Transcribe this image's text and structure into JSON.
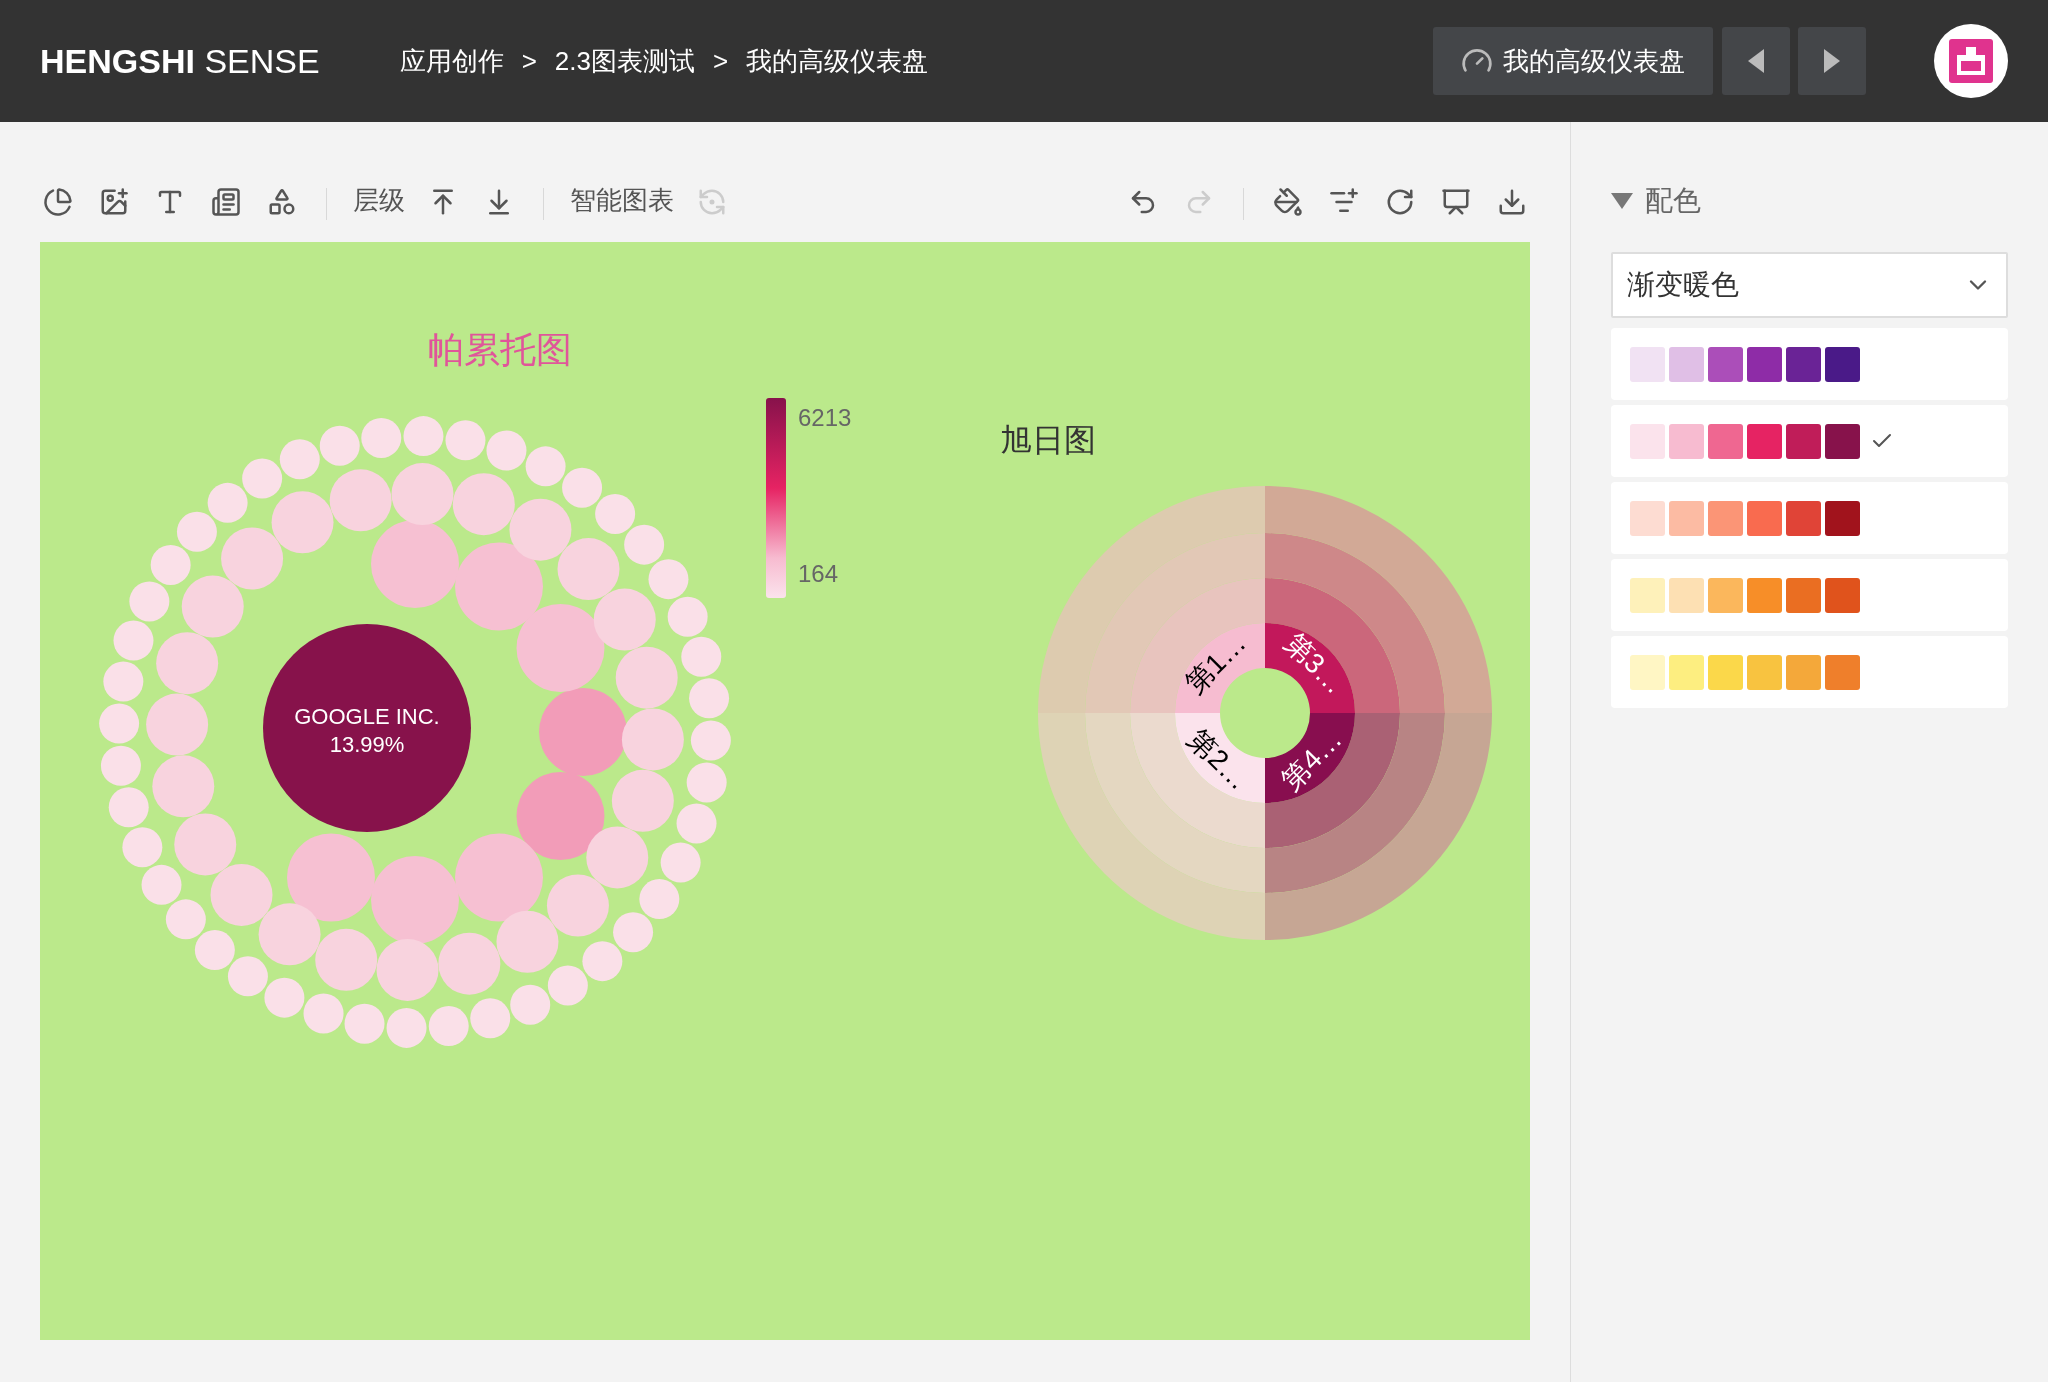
{
  "header": {
    "logo_bold": "HENGSHI",
    "logo_light": "SENSE",
    "breadcrumbs": [
      "应用创作",
      ">",
      "2.3图表测试",
      ">",
      "我的高级仪表盘"
    ],
    "dashboard_button": "我的高级仪表盘"
  },
  "toolbar": {
    "layer_label": "层级",
    "smart_chart_label": "智能图表",
    "smart_chart_icon_disabled": true,
    "undo_disabled": false,
    "redo_disabled": true
  },
  "bubble_chart": {
    "title": "帕累托图",
    "top_label": "GOOGLE INC.",
    "top_share": "13.99%",
    "legend_max": "6213",
    "legend_min": "164"
  },
  "sunburst": {
    "title": "旭日图",
    "segments": [
      {
        "label": "第1…",
        "color": "#f6bcd0"
      },
      {
        "label": "第3…",
        "color": "#c2185b"
      },
      {
        "label": "第4…",
        "color": "#880e4f"
      },
      {
        "label": "第2…",
        "color": "#fbe3ec"
      }
    ]
  },
  "sidebar": {
    "section_title": "配色",
    "expanded": true,
    "scheme_select": "渐变暖色",
    "palettes": [
      {
        "selected": false,
        "colors": [
          {
            "color": "#f1e2f3"
          },
          {
            "color": "#e0bfe6"
          },
          {
            "color": "#ab4eb9"
          },
          {
            "color": "#8e2ca7"
          },
          {
            "color": "#6a2396"
          },
          {
            "color": "#4a1a88"
          }
        ]
      },
      {
        "selected": true,
        "colors": [
          {
            "color": "#fbe3ec"
          },
          {
            "color": "#f7bbd0"
          },
          {
            "color": "#ef6791"
          },
          {
            "color": "#e62363"
          },
          {
            "color": "#c01d59"
          },
          {
            "color": "#87124b"
          }
        ]
      },
      {
        "selected": false,
        "colors": [
          {
            "color": "#fddcd2"
          },
          {
            "color": "#fcbba3"
          },
          {
            "color": "#fb9576"
          },
          {
            "color": "#f96b4f"
          },
          {
            "color": "#e04437"
          },
          {
            "color": "#a1131c"
          }
        ]
      },
      {
        "selected": false,
        "colors": [
          {
            "color": "#fef1ba"
          },
          {
            "color": "#fde0b3"
          },
          {
            "color": "#fbb75c"
          },
          {
            "color": "#f78e28"
          },
          {
            "color": "#ea6e22"
          },
          {
            "color": "#e0531c"
          }
        ]
      },
      {
        "selected": false,
        "colors": [
          {
            "color": "#fff6c4"
          },
          {
            "color": "#fdee80"
          },
          {
            "color": "#fbd84a"
          },
          {
            "color": "#f8c340"
          },
          {
            "color": "#f4a83a"
          },
          {
            "color": "#ef7f2b"
          }
        ]
      }
    ]
  }
}
